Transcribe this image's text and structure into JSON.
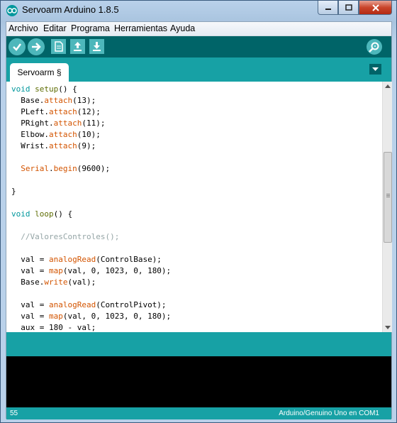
{
  "window": {
    "title": "Servoarm Arduino 1.8.5"
  },
  "menu": [
    "Archivo",
    "Editar",
    "Programa",
    "Herramientas",
    "Ayuda"
  ],
  "toolbar": {
    "buttons": [
      "verify-icon",
      "upload-icon",
      "new-icon",
      "open-icon",
      "save-icon",
      "serial-monitor-icon"
    ]
  },
  "tab": {
    "label": "Servoarm §"
  },
  "code": [
    [
      {
        "t": "void",
        "c": "kw-type"
      },
      {
        "t": " "
      },
      {
        "t": "setup",
        "c": "kw-func"
      },
      {
        "t": "() {"
      }
    ],
    [
      {
        "t": "  Base."
      },
      {
        "t": "attach",
        "c": "kw-method"
      },
      {
        "t": "(13);"
      }
    ],
    [
      {
        "t": "  PLeft."
      },
      {
        "t": "attach",
        "c": "kw-method"
      },
      {
        "t": "(12);"
      }
    ],
    [
      {
        "t": "  PRight."
      },
      {
        "t": "attach",
        "c": "kw-method"
      },
      {
        "t": "(11);"
      }
    ],
    [
      {
        "t": "  Elbow."
      },
      {
        "t": "attach",
        "c": "kw-method"
      },
      {
        "t": "(10);"
      }
    ],
    [
      {
        "t": "  Wrist."
      },
      {
        "t": "attach",
        "c": "kw-method"
      },
      {
        "t": "(9);"
      }
    ],
    [],
    [
      {
        "t": "  "
      },
      {
        "t": "Serial",
        "c": "kw-method"
      },
      {
        "t": "."
      },
      {
        "t": "begin",
        "c": "kw-method"
      },
      {
        "t": "(9600);"
      }
    ],
    [],
    [
      {
        "t": "}"
      }
    ],
    [],
    [
      {
        "t": "void",
        "c": "kw-type"
      },
      {
        "t": " "
      },
      {
        "t": "loop",
        "c": "kw-func"
      },
      {
        "t": "() {"
      }
    ],
    [],
    [
      {
        "t": "  //ValoresControles();",
        "c": "kw-comment"
      }
    ],
    [],
    [
      {
        "t": "  val = "
      },
      {
        "t": "analogRead",
        "c": "kw-method"
      },
      {
        "t": "(ControlBase);"
      }
    ],
    [
      {
        "t": "  val = "
      },
      {
        "t": "map",
        "c": "kw-method"
      },
      {
        "t": "(val, 0, 1023, 0, 180);"
      }
    ],
    [
      {
        "t": "  Base."
      },
      {
        "t": "write",
        "c": "kw-method"
      },
      {
        "t": "(val);"
      }
    ],
    [],
    [
      {
        "t": "  val = "
      },
      {
        "t": "analogRead",
        "c": "kw-method"
      },
      {
        "t": "(ControlPivot);"
      }
    ],
    [
      {
        "t": "  val = "
      },
      {
        "t": "map",
        "c": "kw-method"
      },
      {
        "t": "(val, 0, 1023, 0, 180);"
      }
    ],
    [
      {
        "t": "  aux = 180 - val;"
      }
    ]
  ],
  "status": {
    "line": "55",
    "board": "Arduino/Genuino Uno en COM1"
  },
  "colors": {
    "toolbar": "#006468",
    "tabbar": "#17a1a5",
    "console": "#000000"
  }
}
